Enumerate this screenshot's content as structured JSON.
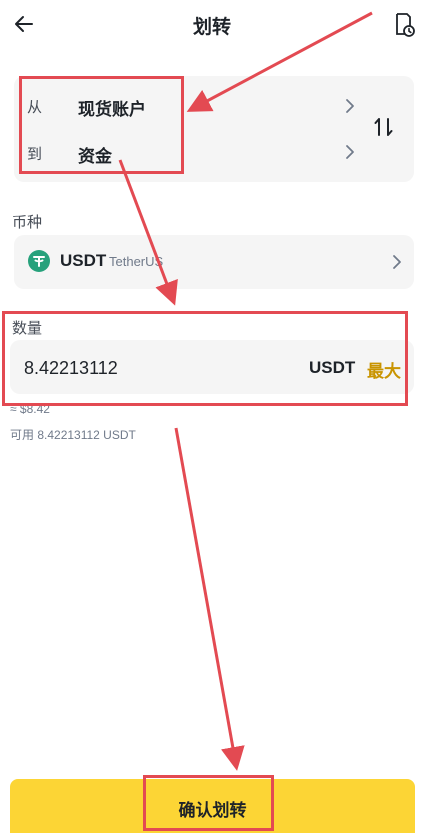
{
  "header": {
    "title": "划转",
    "back_icon": "back-arrow-icon",
    "history_icon": "history-icon"
  },
  "transfer": {
    "from_label": "从",
    "from_value": "现货账户",
    "to_label": "到",
    "to_value": "资金",
    "swap_icon": "swap-icon"
  },
  "currency": {
    "section_label": "币种",
    "symbol": "USDT",
    "name": "TetherUS",
    "icon": "usdt-icon"
  },
  "amount": {
    "section_label": "数量",
    "value": "8.42213112",
    "unit": "USDT",
    "max_label": "最大",
    "approx_value": "≈ $8.42",
    "available": "可用 8.42213112 USDT"
  },
  "confirm": {
    "label": "确认划转"
  },
  "colors": {
    "accent": "#fcd535",
    "max_text": "#c99400",
    "annotation": "#e34a52",
    "coin": "#26a17b"
  }
}
